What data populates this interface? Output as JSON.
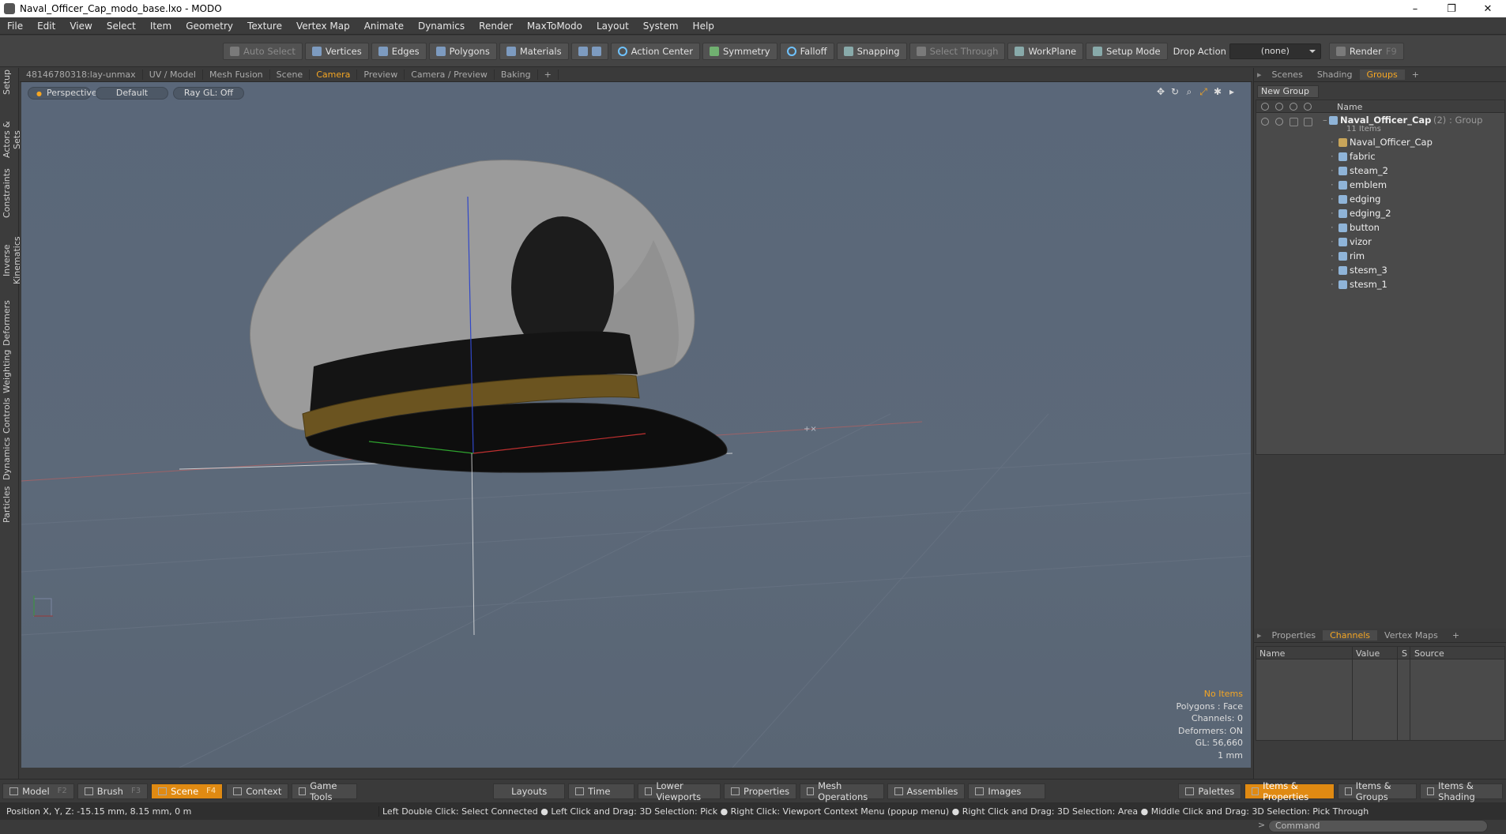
{
  "window": {
    "title": "Naval_Officer_Cap_modo_base.lxo - MODO",
    "min": "–",
    "restore": "❐",
    "close": "✕"
  },
  "menu": [
    "File",
    "Edit",
    "View",
    "Select",
    "Item",
    "Geometry",
    "Texture",
    "Vertex Map",
    "Animate",
    "Dynamics",
    "Render",
    "MaxToModo",
    "Layout",
    "System",
    "Help"
  ],
  "toolbar": {
    "auto_select": "Auto Select",
    "vertices": "Vertices",
    "edges": "Edges",
    "polygons": "Polygons",
    "materials": "Materials",
    "action_center": "Action Center",
    "symmetry": "Symmetry",
    "falloff": "Falloff",
    "snapping": "Snapping",
    "select_through": "Select Through",
    "workplane": "WorkPlane",
    "setup_mode": "Setup Mode",
    "drop_action": "Drop Action",
    "drop_value": "(none)",
    "render": "Render",
    "render_key": "F9"
  },
  "left_tabs": [
    "Setup",
    "Actors & Sets",
    "Constraints",
    "Inverse Kinematics",
    "Deformers",
    "Weighting",
    "Controls",
    "Dynamics",
    "Particles"
  ],
  "viewport_tabs": [
    "48146780318:lay-unmax",
    "UV / Model",
    "Mesh Fusion",
    "Scene",
    "Camera",
    "Preview",
    "Camera / Preview",
    "Baking",
    "+"
  ],
  "viewport": {
    "perspective": "Perspective",
    "shading": "Default",
    "raygl": "Ray GL: Off",
    "info": {
      "items": "No Items",
      "polygons": "Polygons : Face",
      "channels": "Channels: 0",
      "deformers": "Deformers: ON",
      "gl": "GL: 56,660",
      "scale": "1 mm"
    }
  },
  "right_tabs": [
    "Scenes",
    "Shading",
    "Groups",
    "+"
  ],
  "groups": {
    "new_group": "New Group",
    "name_header": "Name",
    "root": {
      "name": "Naval_Officer_Cap",
      "suffix": "(2) : Group",
      "count": "11 Items"
    },
    "items": [
      "Naval_Officer_Cap",
      "fabric",
      "steam_2",
      "emblem",
      "edging",
      "edging_2",
      "button",
      "vizor",
      "rim",
      "stesm_3",
      "stesm_1"
    ]
  },
  "channels": {
    "tabs": [
      "Properties",
      "Channels",
      "Vertex Maps",
      "+"
    ],
    "headers": [
      "Name",
      "Value",
      "S",
      "Source"
    ]
  },
  "command_placeholder": "Command",
  "bottom": {
    "model": "Model",
    "model_key": "F2",
    "brush": "Brush",
    "brush_key": "F3",
    "scene": "Scene",
    "scene_key": "F4",
    "context": "Context",
    "game_tools": "Game Tools",
    "layouts": "Layouts",
    "time": "Time",
    "lower_viewports": "Lower Viewports",
    "properties": "Properties",
    "mesh_ops": "Mesh Operations",
    "assemblies": "Assemblies",
    "images": "Images",
    "palettes": "Palettes",
    "items_props": "Items & Properties",
    "items_groups": "Items & Groups",
    "items_shading": "Items & Shading"
  },
  "status": {
    "position": "Position X, Y, Z:  -15.15 mm, 8.15 mm, 0 m",
    "hint": "Left Double Click: Select Connected ● Left Click and Drag: 3D Selection: Pick ● Right Click: Viewport Context Menu (popup menu) ● Right Click and Drag: 3D Selection: Area ● Middle Click and Drag: 3D Selection: Pick Through"
  },
  "colors": {
    "accent": "#f5a623",
    "viewport_bg": "#5a6779",
    "active_tab": "#e08a12"
  }
}
